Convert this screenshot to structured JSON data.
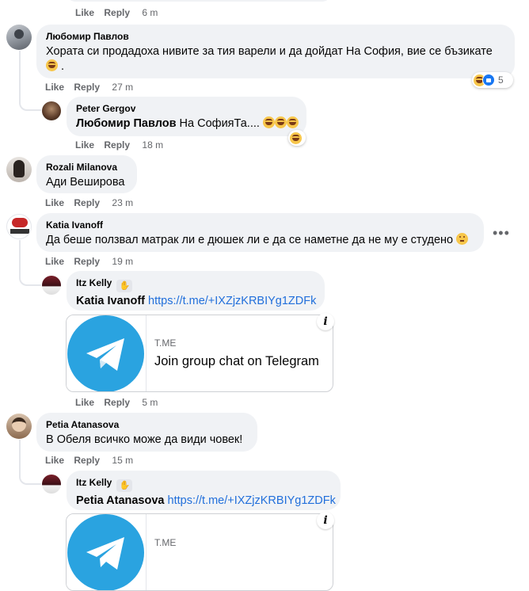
{
  "actions": {
    "like": "Like",
    "reply": "Reply"
  },
  "top": {
    "time": "6 m"
  },
  "comments": [
    {
      "author": "Любомир Павлов",
      "text_line1": "Хората си продадоха нивите за тия варели и да дойдат На София, вие се бъзикате",
      "time": "27 m",
      "reaction_count": "5",
      "reply": {
        "author": "Peter Gergov",
        "mention": "Любомир Павлов",
        "text": "На СофияТа....",
        "time": "18 m"
      }
    },
    {
      "author": "Rozali Milanova",
      "text": "Ади Beширова",
      "time": "23 m"
    },
    {
      "author": "Katia Ivanoff",
      "text": "Да беше ползвал матрак ли е дюшек ли е да се наметне да не му е студено",
      "time": "19 m",
      "more": "•••",
      "reply": {
        "author": "Itz Kelly",
        "mention": "Katia Ivanoff",
        "link": "https://t.me/+IXZjzKRBIYg1ZDFk",
        "card": {
          "domain": "T.ME",
          "title": "Join group chat on Telegram",
          "info": "i"
        },
        "time": "5 m"
      }
    },
    {
      "author": "Petia Atanasova",
      "text": "В Обеля всичко може да види човек!",
      "time": "15 m",
      "reply": {
        "author": "Itz Kelly",
        "mention": "Petia Atanasova",
        "link": "https://t.me/+IXZjzKRBIYg1ZDFk",
        "card": {
          "domain": "T.ME",
          "info": "i"
        }
      }
    }
  ],
  "colors": {
    "bubble": "#f0f2f5",
    "link": "#216fdb",
    "meta": "#65676b",
    "telegram": "#2aa3e0",
    "like": "#1877f2"
  }
}
